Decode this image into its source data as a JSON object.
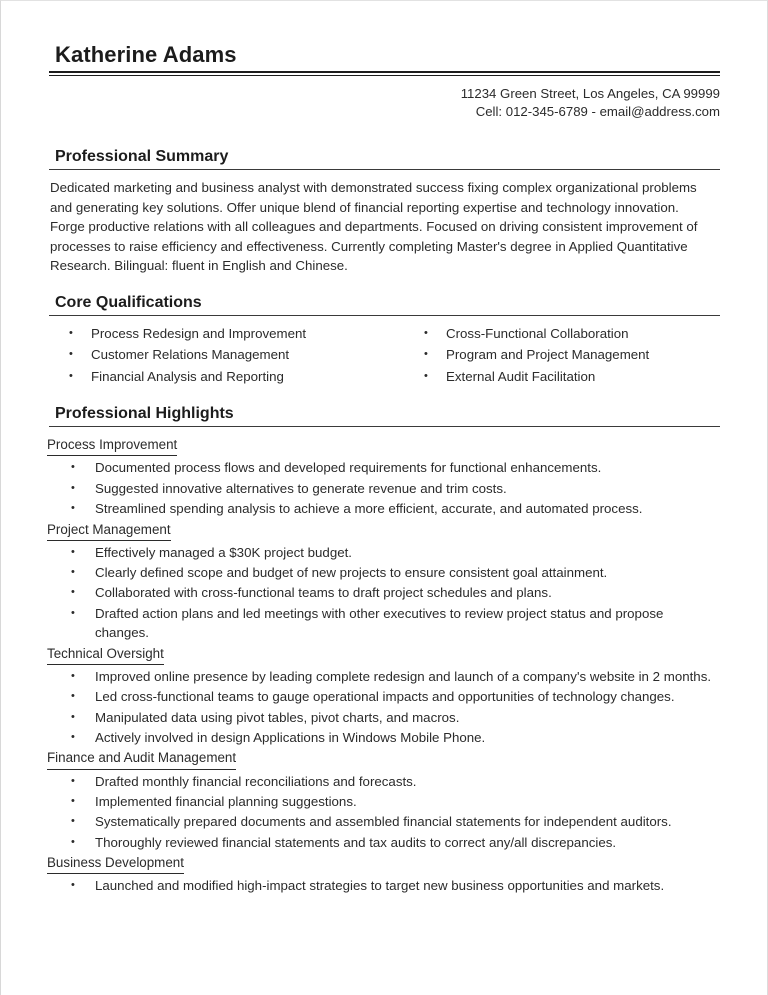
{
  "document": {
    "type": "resume",
    "name": "Katherine Adams",
    "contact": {
      "address": "11234 Green Street, Los Angeles, CA 99999",
      "line2": "Cell: 012-345-6789 - email@address.com"
    }
  },
  "sections": {
    "summary": {
      "heading": "Professional Summary",
      "text": "Dedicated marketing and business analyst with demonstrated success fixing complex organizational problems and generating key solutions. Offer unique blend of financial reporting expertise and technology innovation. Forge productive relations with all colleagues and departments. Focused on driving consistent improvement of processes to raise efficiency and effectiveness. Currently completing Master's degree in Applied Quantitative Research. Bilingual: fluent in English and Chinese."
    },
    "qualifications": {
      "heading": "Core Qualifications",
      "column_left": [
        "Process Redesign and Improvement",
        "Customer Relations Management",
        "Financial Analysis and Reporting"
      ],
      "column_right": [
        "Cross-Functional Collaboration",
        "Program and Project Management",
        "External Audit Facilitation"
      ]
    },
    "highlights": {
      "heading": "Professional Highlights",
      "groups": [
        {
          "title": "Process Improvement",
          "items": [
            "Documented process flows and developed requirements for functional enhancements.",
            "Suggested innovative alternatives to generate revenue and trim costs.",
            "Streamlined spending analysis to achieve a more efficient, accurate, and automated process."
          ]
        },
        {
          "title": "Project Management",
          "items": [
            "Effectively managed a $30K project budget.",
            "Clearly defined scope and budget of new projects to ensure consistent goal attainment.",
            "Collaborated with cross-functional teams to draft project schedules and plans.",
            "Drafted action plans and led meetings with other executives to review project status and propose changes."
          ]
        },
        {
          "title": "Technical Oversight",
          "items": [
            "Improved online presence by leading complete redesign and launch of a company's website in 2 months.",
            "Led cross-functional teams to gauge operational impacts and opportunities of technology changes.",
            "Manipulated data using pivot tables, pivot charts, and macros.",
            "Actively involved in design Applications in Windows Mobile Phone."
          ]
        },
        {
          "title": "Finance and Audit Management",
          "items": [
            "Drafted monthly financial reconciliations and forecasts.",
            "Implemented financial planning suggestions.",
            "Systematically prepared documents and assembled financial statements for independent auditors.",
            "Thoroughly reviewed financial statements and tax audits to correct any/all discrepancies."
          ]
        },
        {
          "title": "Business Development",
          "items": [
            "Launched and modified high-impact strategies to target new business opportunities and markets."
          ]
        }
      ]
    }
  },
  "bullet_glyph": "•",
  "colors": {
    "text": "#2b2b2b",
    "heading": "#1c1c1c",
    "rule": "#3a3a3a",
    "page_background": "#ffffff"
  }
}
